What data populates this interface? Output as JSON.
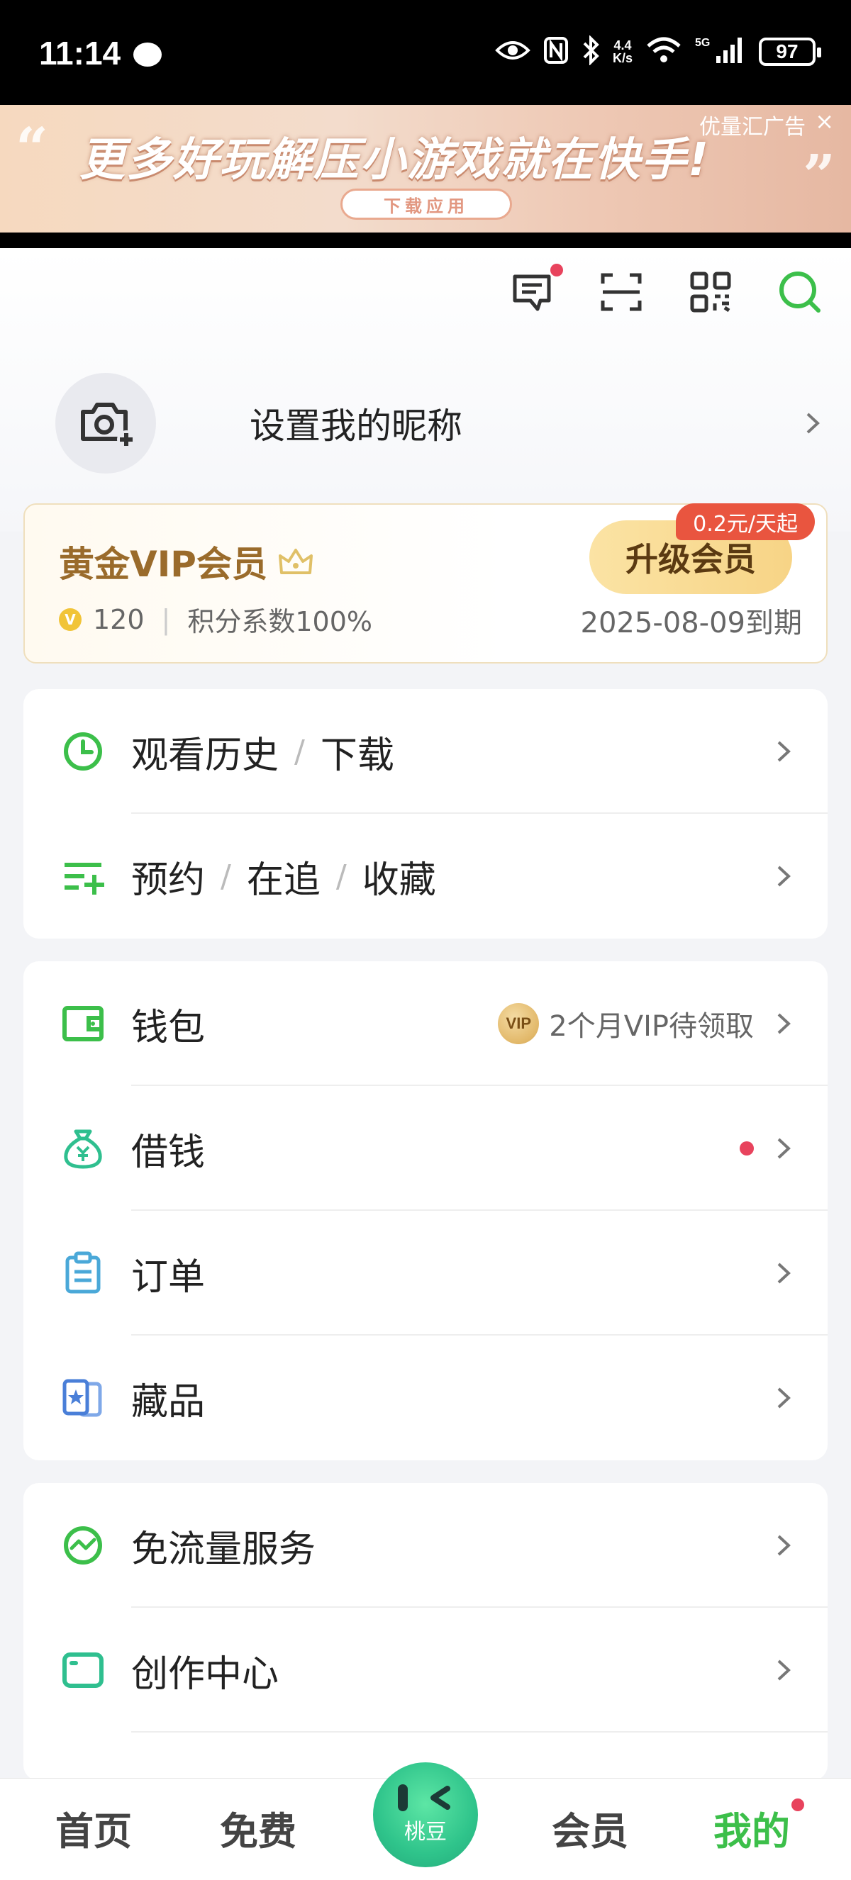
{
  "status_bar": {
    "time": "11:14",
    "net_speed_value": "4.4",
    "net_speed_unit": "K/s",
    "signal_label": "5G",
    "battery": "97"
  },
  "ad": {
    "headline": "更多好玩解压小游戏就在快手!",
    "cta": "下载应用",
    "tag": "优量汇广告",
    "close": "×"
  },
  "profile": {
    "nickname_prompt": "设置我的昵称"
  },
  "vip": {
    "title": "黄金VIP会员",
    "points": "120",
    "coefficient": "积分系数100%",
    "upgrade_label": "升级会员",
    "price_tag": "0.2元/天起",
    "expiry": "2025-08-09到期"
  },
  "menu_group1": {
    "history": "观看历史",
    "download": "下载",
    "reserve": "预约",
    "following": "在追",
    "favorites": "收藏"
  },
  "menu_group2": {
    "wallet": "钱包",
    "wallet_coin": "VIP",
    "wallet_info": "2个月VIP待领取",
    "loan": "借钱",
    "orders": "订单",
    "collectibles": "藏品"
  },
  "menu_group3": {
    "free_data": "免流量服务",
    "creator": "创作中心"
  },
  "bottom_nav": {
    "home": "首页",
    "free": "免费",
    "center": "桃豆",
    "member": "会员",
    "mine": "我的"
  },
  "colors": {
    "accent_green": "#3cbf4a",
    "vip_gold": "#9a6b2b",
    "notification_red": "#e8435d"
  }
}
